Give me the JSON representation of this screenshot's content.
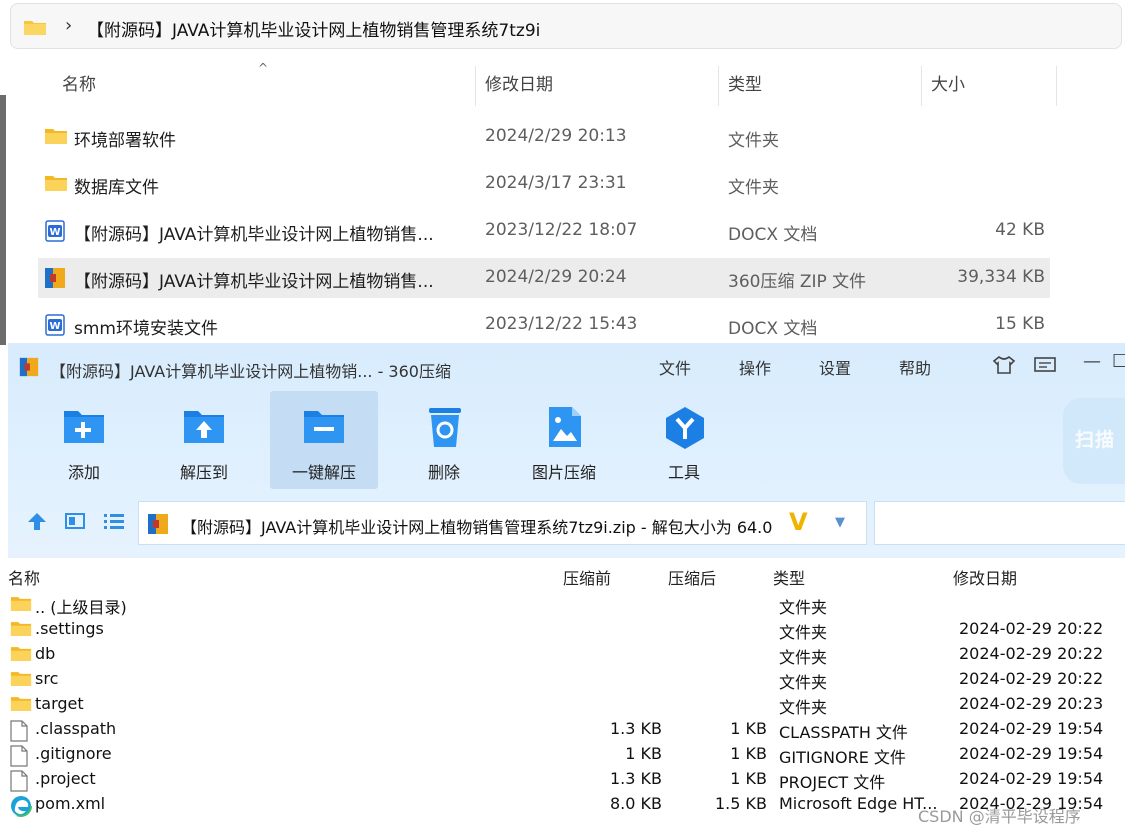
{
  "explorer": {
    "breadcrumb": "【附源码】JAVA计算机毕业设计网上植物销售管理系统7tz9i",
    "columns": {
      "name": "名称",
      "date": "修改日期",
      "type": "类型",
      "size": "大小"
    },
    "rows": [
      {
        "icon": "folder-icon",
        "name": "环境部署软件",
        "date": "2024/2/29 20:13",
        "type": "文件夹",
        "size": ""
      },
      {
        "icon": "folder-icon",
        "name": "数据库文件",
        "date": "2024/3/17 23:31",
        "type": "文件夹",
        "size": ""
      },
      {
        "icon": "word-doc-icon",
        "name": "【附源码】JAVA计算机毕业设计网上植物销售...",
        "date": "2023/12/22 18:07",
        "type": "DOCX 文档",
        "size": "42 KB"
      },
      {
        "icon": "zip-archive-icon",
        "name": "【附源码】JAVA计算机毕业设计网上植物销售...",
        "date": "2024/2/29 20:24",
        "type": "360压缩 ZIP 文件",
        "size": "39,334 KB"
      },
      {
        "icon": "word-doc-icon",
        "name": "smm环境安装文件",
        "date": "2023/12/22 15:43",
        "type": "DOCX 文档",
        "size": "15 KB"
      }
    ]
  },
  "zip_window": {
    "title": "【附源码】JAVA计算机毕业设计网上植物销... - 360压缩",
    "menu": [
      "文件",
      "操作",
      "设置",
      "帮助"
    ],
    "toolbar": {
      "add": "添加",
      "extract_to": "解压到",
      "one_click_extract": "一键解压",
      "delete": "删除",
      "image_compress": "图片压缩",
      "tools": "工具"
    },
    "scan_label": "扫描",
    "path_text": "【附源码】JAVA计算机毕业设计网上植物销售管理系统7tz9i.zip - 解包大小为 64.0",
    "columns": {
      "name": "名称",
      "before": "压缩前",
      "after": "压缩后",
      "type": "类型",
      "date": "修改日期"
    },
    "rows": [
      {
        "icon": "folder-icon",
        "name": ".. (上级目录)",
        "before": "",
        "after": "",
        "type": "文件夹",
        "date": ""
      },
      {
        "icon": "folder-icon",
        "name": ".settings",
        "before": "",
        "after": "",
        "type": "文件夹",
        "date": "2024-02-29 20:22"
      },
      {
        "icon": "folder-icon",
        "name": "db",
        "before": "",
        "after": "",
        "type": "文件夹",
        "date": "2024-02-29 20:22"
      },
      {
        "icon": "folder-icon",
        "name": "src",
        "before": "",
        "after": "",
        "type": "文件夹",
        "date": "2024-02-29 20:22"
      },
      {
        "icon": "folder-icon",
        "name": "target",
        "before": "",
        "after": "",
        "type": "文件夹",
        "date": "2024-02-29 20:23"
      },
      {
        "icon": "file-icon",
        "name": ".classpath",
        "before": "1.3 KB",
        "after": "1 KB",
        "type": "CLASSPATH 文件",
        "date": "2024-02-29 19:54"
      },
      {
        "icon": "file-icon",
        "name": ".gitignore",
        "before": "1 KB",
        "after": "1 KB",
        "type": "GITIGNORE 文件",
        "date": "2024-02-29 19:54"
      },
      {
        "icon": "file-icon",
        "name": ".project",
        "before": "1.3 KB",
        "after": "1 KB",
        "type": "PROJECT 文件",
        "date": "2024-02-29 19:54"
      },
      {
        "icon": "edge-icon",
        "name": "pom.xml",
        "before": "8.0 KB",
        "after": "1.5 KB",
        "type": "Microsoft Edge HT...",
        "date": "2024-02-29 19:54"
      }
    ]
  },
  "watermark": "CSDN @清平毕设程序"
}
